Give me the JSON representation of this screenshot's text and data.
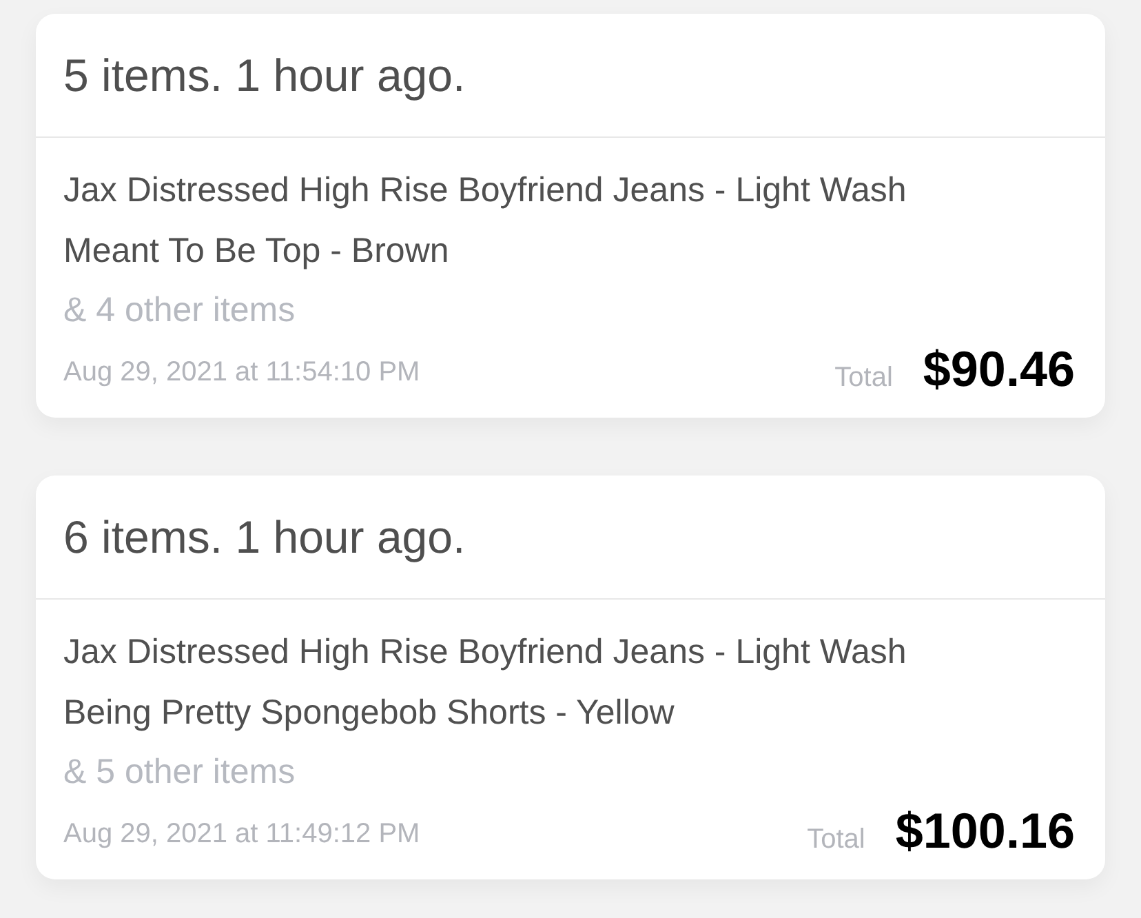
{
  "orders": [
    {
      "title": "5 items. 1 hour ago.",
      "items": [
        "Jax Distressed High Rise Boyfriend Jeans - Light Wash",
        "Meant To Be Top - Brown"
      ],
      "more": "& 4 other items",
      "date": "Aug 29, 2021 at 11:54:10 PM",
      "total_label": "Total",
      "total": "$90.46"
    },
    {
      "title": "6 items. 1 hour ago.",
      "items": [
        "Jax Distressed High Rise Boyfriend Jeans - Light Wash",
        "Being Pretty Spongebob Shorts - Yellow"
      ],
      "more": "& 5 other items",
      "date": "Aug 29, 2021 at 11:49:12 PM",
      "total_label": "Total",
      "total": "$100.16"
    }
  ]
}
